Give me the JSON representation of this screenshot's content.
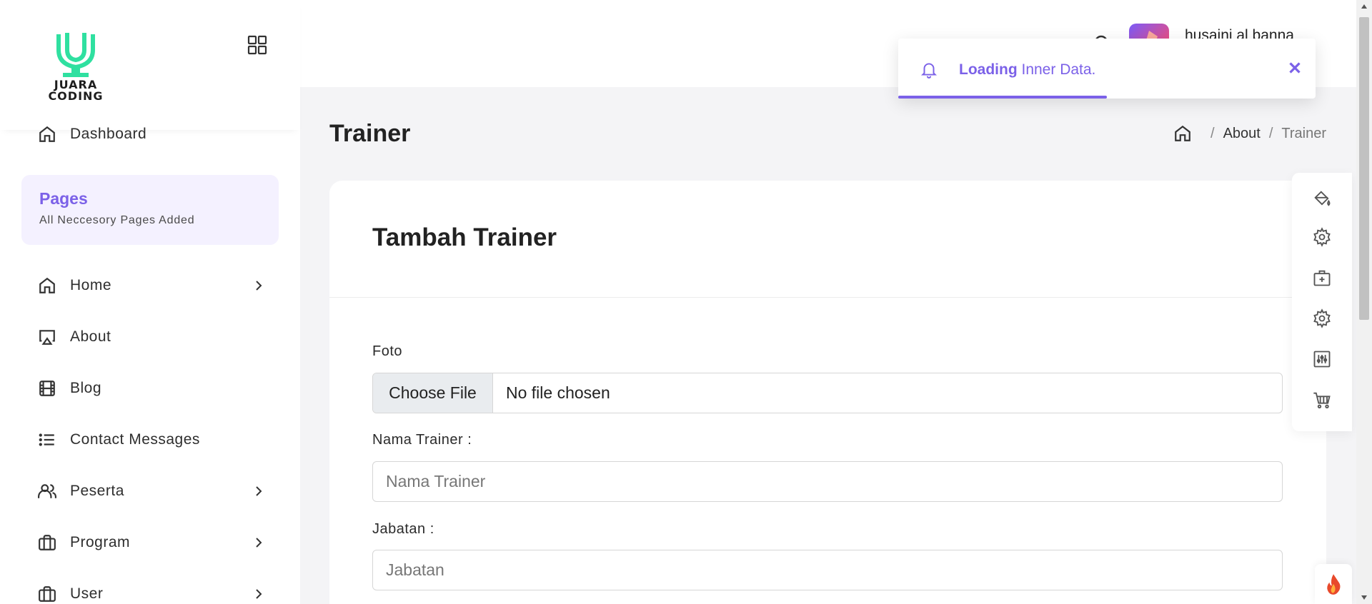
{
  "brand": {
    "logo_line1": "JUARA",
    "logo_line2": "CODING",
    "accent": "#7b61e8",
    "logo_green": "#2fe0a0"
  },
  "header": {
    "user_name": "husaini al banna"
  },
  "toast": {
    "icon": "bell-icon",
    "bold": "Loading",
    "text": " Inner Data.",
    "progress": 0.5
  },
  "sidebar": {
    "pages": {
      "title": "Pages",
      "subtitle": "All Neccesory Pages Added"
    },
    "items": [
      {
        "label": "Dashboard",
        "icon": "home-icon",
        "has_submenu": false
      },
      {
        "label": "Home",
        "icon": "home-icon",
        "has_submenu": true
      },
      {
        "label": "About",
        "icon": "airplay-icon",
        "has_submenu": false
      },
      {
        "label": "Blog",
        "icon": "film-icon",
        "has_submenu": false
      },
      {
        "label": "Contact Messages",
        "icon": "list-icon",
        "has_submenu": false
      },
      {
        "label": "Peserta",
        "icon": "users-icon",
        "has_submenu": true
      },
      {
        "label": "Program",
        "icon": "briefcase-icon",
        "has_submenu": true
      },
      {
        "label": "User",
        "icon": "briefcase-icon",
        "has_submenu": true
      }
    ]
  },
  "page": {
    "title": "Trainer",
    "breadcrumb": [
      "About",
      "Trainer"
    ]
  },
  "form": {
    "title": "Tambah Trainer",
    "foto_label": "Foto",
    "file_button": "Choose File",
    "file_status": "No file chosen",
    "nama_label": "Nama Trainer :",
    "nama_placeholder": "Nama Trainer",
    "jabatan_label": "Jabatan :",
    "jabatan_placeholder": "Jabatan"
  },
  "side_tools": [
    "paint-bucket-icon",
    "gear-icon",
    "medical-bag-icon",
    "gear-icon",
    "sliders-icon",
    "cart-icon"
  ]
}
